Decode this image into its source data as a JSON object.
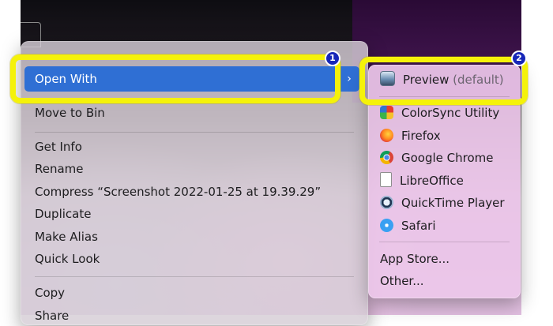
{
  "context_menu": {
    "open_with_label": "Open With",
    "open_with_chevron": "›",
    "items": [
      {
        "label": "Move to Bin"
      },
      {
        "label": "Get Info"
      },
      {
        "label": "Rename"
      },
      {
        "label": "Compress “Screenshot 2022-01-25 at 19.39.29”"
      },
      {
        "label": "Duplicate"
      },
      {
        "label": "Make Alias"
      },
      {
        "label": "Quick Look"
      },
      {
        "label": "Copy"
      },
      {
        "label": "Share"
      }
    ]
  },
  "open_with_submenu": {
    "default_app": {
      "name": "Preview",
      "hint": "(default)",
      "icon": "preview-icon"
    },
    "apps": [
      {
        "name": "ColorSync Utility",
        "icon": "colorsync-icon"
      },
      {
        "name": "Firefox",
        "icon": "firefox-icon"
      },
      {
        "name": "Google Chrome",
        "icon": "chrome-icon"
      },
      {
        "name": "LibreOffice",
        "icon": "libreoffice-icon"
      },
      {
        "name": "QuickTime Player",
        "icon": "quicktime-icon"
      },
      {
        "name": "Safari",
        "icon": "safari-icon"
      }
    ],
    "footer": [
      {
        "label": "App Store..."
      },
      {
        "label": "Other..."
      }
    ]
  },
  "annotations": {
    "step1": "1",
    "step2": "2",
    "highlight_color": "#f5f20a",
    "badge_color": "#1727b8"
  },
  "colors": {
    "selection": "#2f6fd4"
  }
}
